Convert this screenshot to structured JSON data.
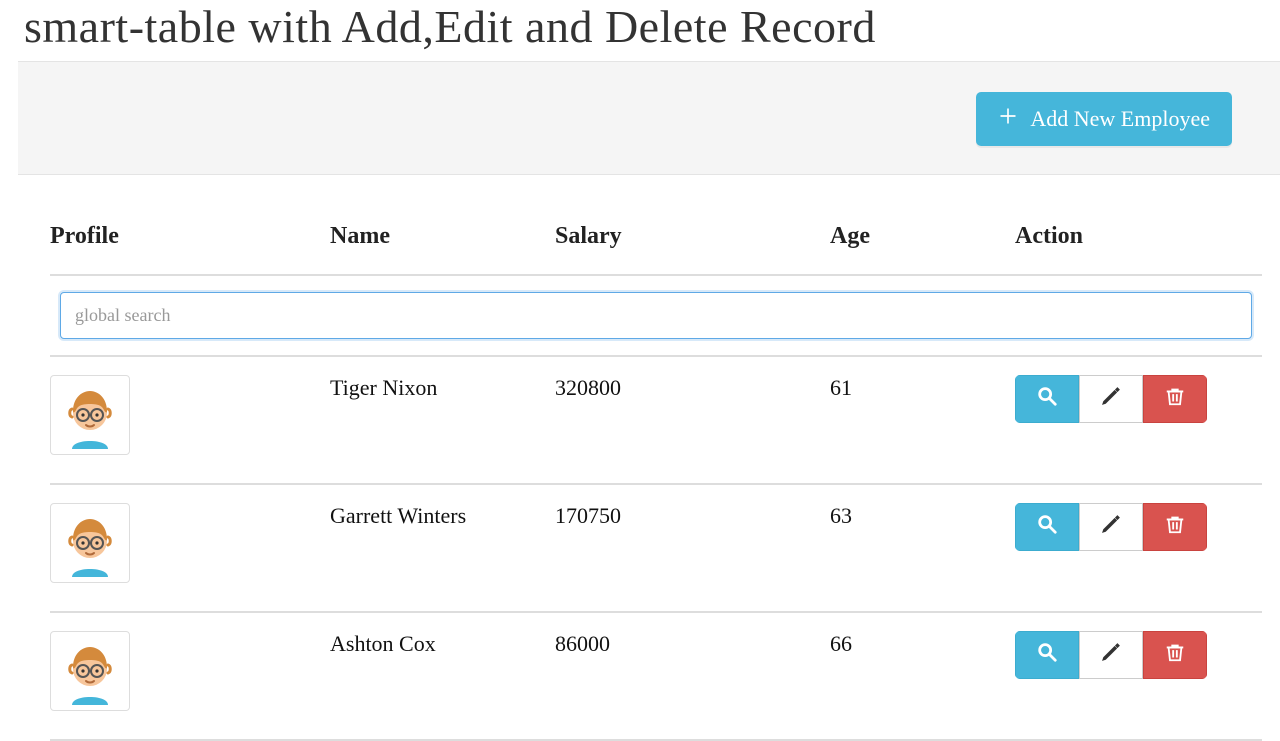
{
  "title": "smart-table with Add,Edit and Delete Record",
  "toolbar": {
    "add_label": "Add New Employee"
  },
  "search": {
    "placeholder": "global search",
    "value": ""
  },
  "columns": {
    "profile": "Profile",
    "name": "Name",
    "salary": "Salary",
    "age": "Age",
    "action": "Action"
  },
  "rows": [
    {
      "name": "Tiger Nixon",
      "salary": "320800",
      "age": "61"
    },
    {
      "name": "Garrett Winters",
      "salary": "170750",
      "age": "63"
    },
    {
      "name": "Ashton Cox",
      "salary": "86000",
      "age": "66"
    }
  ],
  "icons": {
    "plus": "plus-icon",
    "search": "search-icon",
    "edit": "pencil-icon",
    "delete": "trash-icon"
  },
  "colors": {
    "accent": "#45b6da",
    "danger": "#d9534f",
    "panel": "#f5f5f5",
    "focus": "#5fa9e6"
  }
}
